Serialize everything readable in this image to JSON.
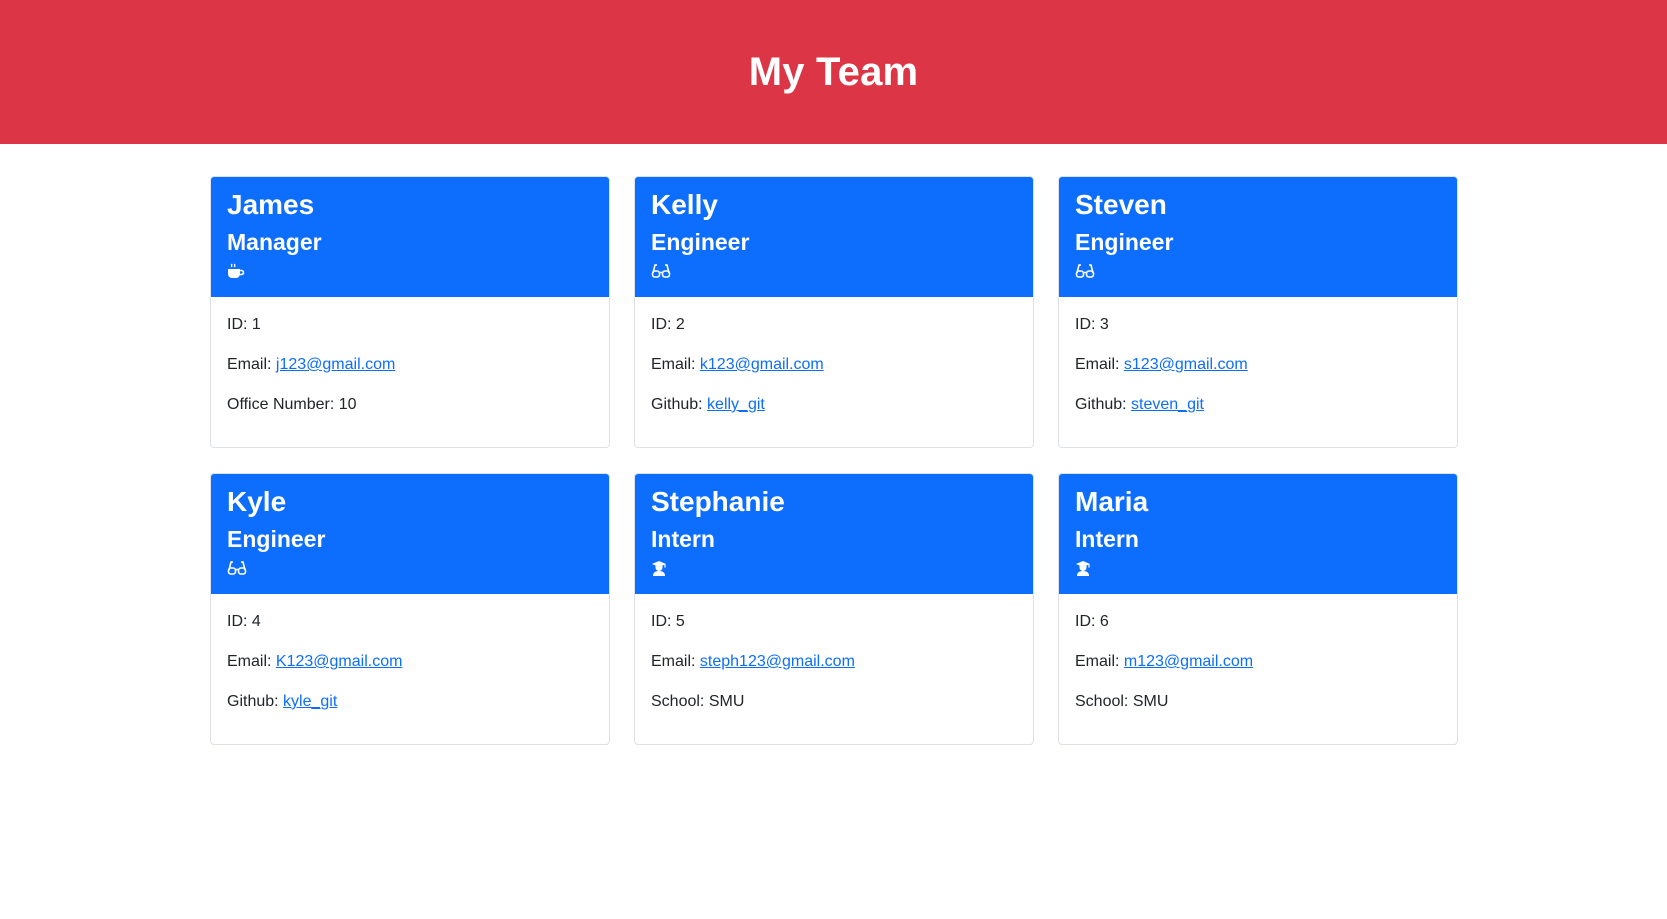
{
  "page": {
    "title": "My Team"
  },
  "members": [
    {
      "name": "James",
      "role": "Manager",
      "icon": "coffee-icon",
      "id_label": "ID:",
      "id": "1",
      "email_label": "Email:",
      "email": "j123@gmail.com",
      "extra_label": "Office Number:",
      "extra": "10",
      "extra_is_link": false
    },
    {
      "name": "Kelly",
      "role": "Engineer",
      "icon": "glasses-icon",
      "id_label": "ID:",
      "id": "2",
      "email_label": "Email:",
      "email": "k123@gmail.com",
      "extra_label": "Github:",
      "extra": "kelly_git",
      "extra_is_link": true
    },
    {
      "name": "Steven",
      "role": "Engineer",
      "icon": "glasses-icon",
      "id_label": "ID:",
      "id": "3",
      "email_label": "Email:",
      "email": "s123@gmail.com",
      "extra_label": "Github:",
      "extra": "steven_git",
      "extra_is_link": true
    },
    {
      "name": "Kyle",
      "role": "Engineer",
      "icon": "glasses-icon",
      "id_label": "ID:",
      "id": "4",
      "email_label": "Email:",
      "email": "K123@gmail.com",
      "extra_label": "Github:",
      "extra": "kyle_git",
      "extra_is_link": true
    },
    {
      "name": "Stephanie",
      "role": "Intern",
      "icon": "graduate-icon",
      "id_label": "ID:",
      "id": "5",
      "email_label": "Email:",
      "email": "steph123@gmail.com",
      "extra_label": "School:",
      "extra": "SMU",
      "extra_is_link": false
    },
    {
      "name": "Maria",
      "role": "Intern",
      "icon": "graduate-icon",
      "id_label": "ID:",
      "id": "6",
      "email_label": "Email:",
      "email": "m123@gmail.com",
      "extra_label": "School:",
      "extra": "SMU",
      "extra_is_link": false
    }
  ],
  "colors": {
    "header_bg": "#dc3545",
    "card_header_bg": "#0d6efd",
    "link": "#0d6efd"
  }
}
